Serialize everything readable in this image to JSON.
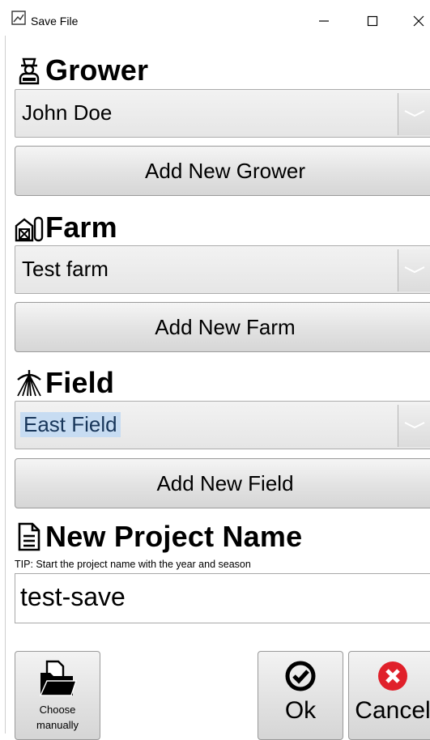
{
  "window": {
    "title": "Save File",
    "controls": {
      "minimize": "—",
      "maximize": "☐",
      "close": "✕"
    }
  },
  "grower": {
    "heading": "Grower",
    "selected": "John Doe",
    "add_button": "Add New Grower"
  },
  "farm": {
    "heading": "Farm",
    "selected": "Test farm",
    "add_button": "Add New Farm"
  },
  "field": {
    "heading": "Field",
    "selected": "East Field",
    "add_button": "Add New Field"
  },
  "project": {
    "heading": "New Project Name",
    "tip": "TIP: Start the project name with the year and season",
    "value": "test-save"
  },
  "actions": {
    "choose_manually_line1": "Choose",
    "choose_manually_line2": "manually",
    "ok": "Ok",
    "cancel": "Cancel"
  },
  "icons": {
    "grower": "grower-person-icon",
    "farm": "barn-silo-icon",
    "field": "irrigation-pivot-icon",
    "project": "document-icon",
    "choose": "folder-document-icon",
    "ok": "check-circle-icon",
    "cancel": "x-circle-icon"
  },
  "colors": {
    "selection_highlight": "#c7dcf2",
    "cancel_red": "#e0202a"
  }
}
